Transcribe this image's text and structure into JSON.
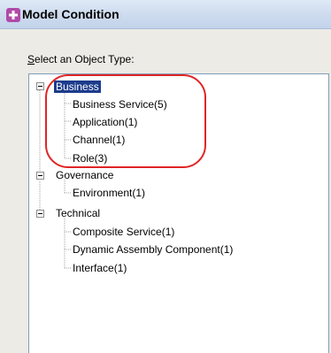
{
  "window": {
    "title": "Model Condition",
    "icon": "model-condition-icon"
  },
  "prompt": {
    "mnemonic": "S",
    "rest": "elect an Object Type:"
  },
  "tree": {
    "groups": [
      {
        "label": "Business",
        "selected": true,
        "children": [
          "Business Service(5)",
          "Application(1)",
          "Channel(1)",
          "Role(3)"
        ]
      },
      {
        "label": "Governance",
        "selected": false,
        "children": [
          "Environment(1)"
        ]
      },
      {
        "label": "Technical",
        "selected": false,
        "children": [
          "Composite Service(1)",
          "Dynamic Assembly Component(1)",
          "Interface(1)"
        ]
      }
    ]
  },
  "colors": {
    "selection": "#1c3c8c",
    "annotation": "#e02525",
    "tree_line": "#a0a0a0"
  }
}
